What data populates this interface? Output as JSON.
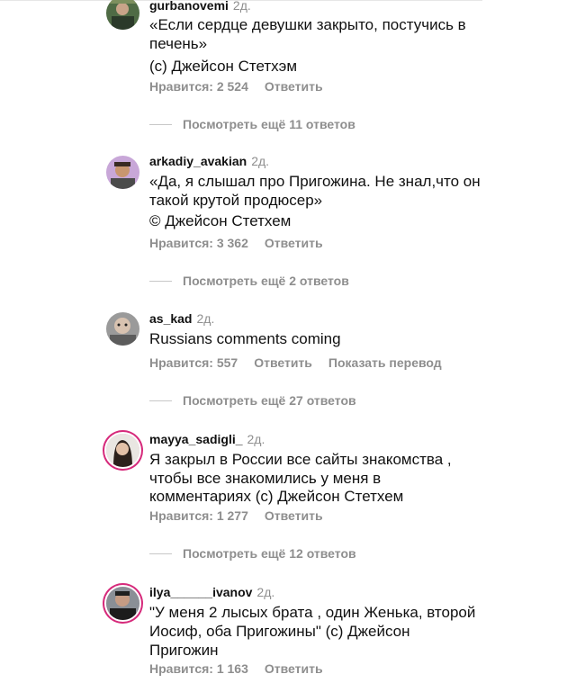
{
  "comments": [
    {
      "username": "gurbanovemi",
      "time": "2д.",
      "lines": [
        "«Если сердце девушки закрыто, постучись в",
        "печень»",
        "(с) Джейсон Стетхэм"
      ],
      "likes": "Нравится: 2 524",
      "reply": "Ответить",
      "more_replies": "Посмотреть ещё 11 ответов"
    },
    {
      "username": "arkadiy_avakian",
      "time": "2д.",
      "lines": [
        "«Да, я слышал про Пригожина. Не знал,что он",
        "такой крутой продюсер»",
        "© Джейсон Стетхем"
      ],
      "likes": "Нравится: 3 362",
      "reply": "Ответить",
      "more_replies": "Посмотреть ещё 2 ответов"
    },
    {
      "username": "as_kad",
      "time": "2д.",
      "lines": [
        "Russians comments coming"
      ],
      "likes": "Нравится: 557",
      "reply": "Ответить",
      "translate": "Показать перевод",
      "more_replies": "Посмотреть ещё 27 ответов"
    },
    {
      "username": "mayya_sadigli_",
      "time": "2д.",
      "lines": [
        "Я закрыл в России все сайты знакомства ,",
        "чтобы все знакомились у меня в",
        "комментариях (с) Джейсон Стетхем"
      ],
      "likes": "Нравится: 1 277",
      "reply": "Ответить",
      "more_replies": "Посмотреть ещё 12 ответов"
    },
    {
      "username": "ilya______ivanov",
      "time": "2д.",
      "lines": [
        "\"У меня 2 лысых брата , один Женька, второй",
        "Иосиф, оба Пригожины\" (с) Джейсон",
        "Пригожин"
      ],
      "likes": "Нравится: 1 163",
      "reply": "Ответить"
    }
  ]
}
